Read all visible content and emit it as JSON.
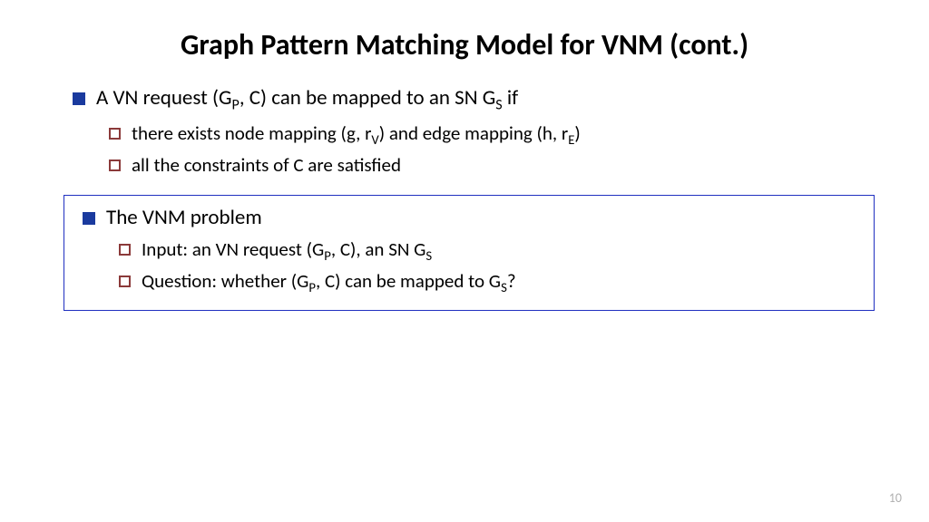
{
  "title": "Graph Pattern Matching Model for VNM (cont.)",
  "section1": {
    "main_prefix": "A VN request (G",
    "main_sub1": "P",
    "main_mid": ", C) can be mapped to an SN G",
    "main_sub2": "S",
    "main_suffix": " if",
    "sub1_prefix": "there exists node mapping (g, r",
    "sub1_sub1": "V",
    "sub1_mid": ") and edge mapping (h, r",
    "sub1_sub2": "E",
    "sub1_suffix": ")",
    "sub2": "all the constraints of C are satisfied"
  },
  "section2": {
    "main": "The VNM problem",
    "sub1_prefix": "Input: an VN request (G",
    "sub1_sub1": "P",
    "sub1_mid": ", C), an SN G",
    "sub1_sub2": "S",
    "sub2_prefix": "Question:  whether (G",
    "sub2_sub1": "P",
    "sub2_mid": ", C) can be mapped to  G",
    "sub2_sub2": "S",
    "sub2_suffix": "?"
  },
  "page_number": "10"
}
